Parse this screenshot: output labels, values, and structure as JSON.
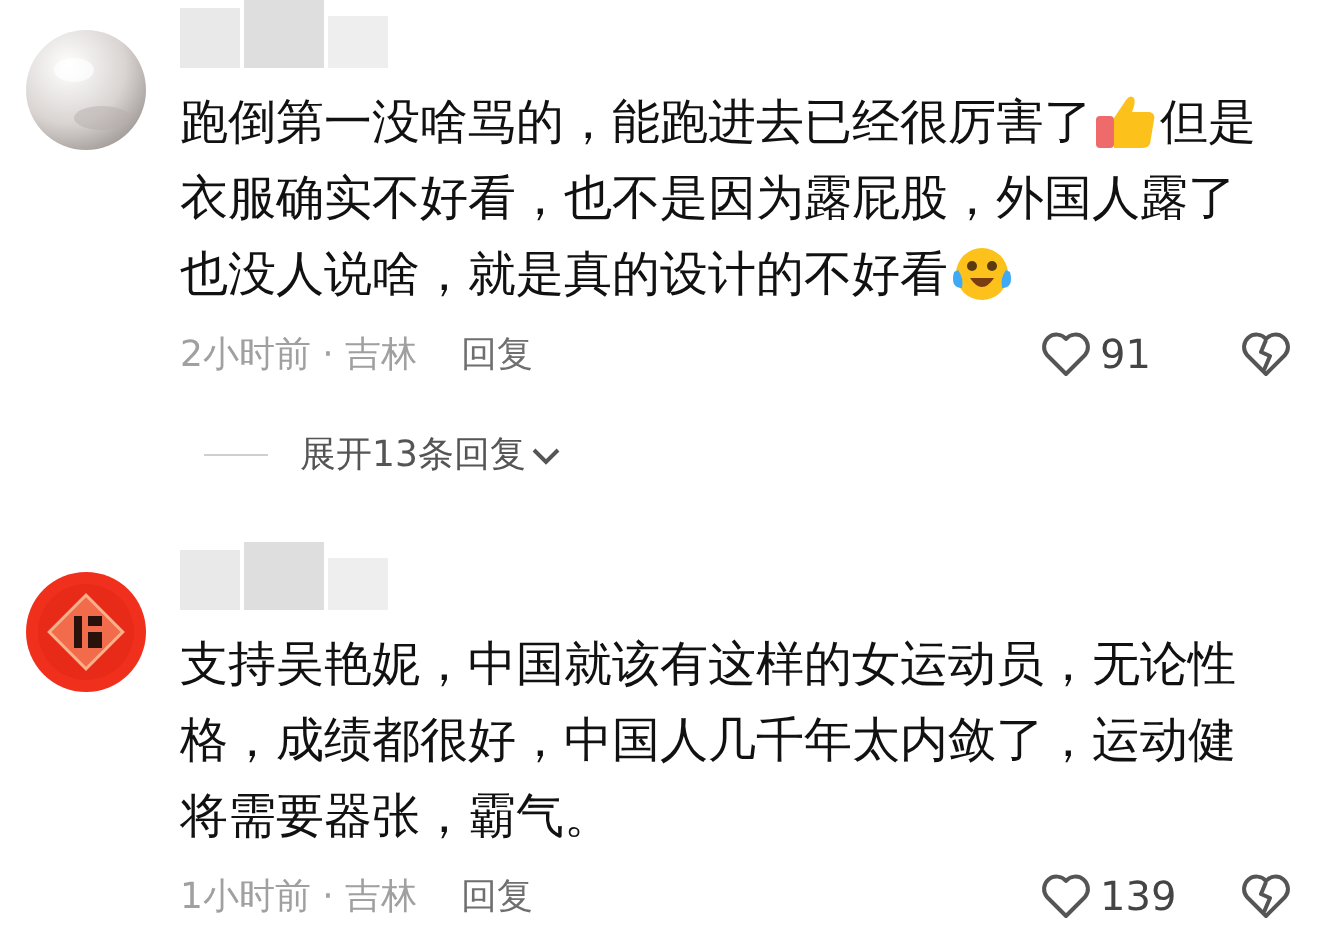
{
  "comments": [
    {
      "avatar": {
        "kind": "pearl"
      },
      "lines": [
        [
          {
            "kind": "text",
            "text": "跑倒第一没啥骂的，能跑进去已经很厉害了"
          },
          {
            "kind": "thumbs_up"
          },
          {
            "kind": "text",
            "text": "但是"
          }
        ],
        [
          {
            "kind": "text",
            "text": "衣服确实不好看，也不是因为露屁股，外国人露了"
          }
        ],
        [
          {
            "kind": "text",
            "text": "也没人说啥，就是真的设计的不好看"
          },
          {
            "kind": "laugh_cry"
          }
        ]
      ],
      "time": "2小时前 · 吉林",
      "reply": "回复",
      "likes": "91",
      "expand": {
        "label": "展开13条回复"
      }
    },
    {
      "avatar": {
        "kind": "fu"
      },
      "lines": [
        [
          {
            "kind": "text",
            "text": "支持吴艳妮，中国就该有这样的女运动员，无论性"
          }
        ],
        [
          {
            "kind": "text",
            "text": "格，成绩都很好，中国人几千年太内敛了，运动健"
          }
        ],
        [
          {
            "kind": "text",
            "text": "将需要器张，霸气。"
          }
        ]
      ],
      "time": "1小时前 · 吉林",
      "reply": "回复",
      "likes": "139"
    }
  ]
}
